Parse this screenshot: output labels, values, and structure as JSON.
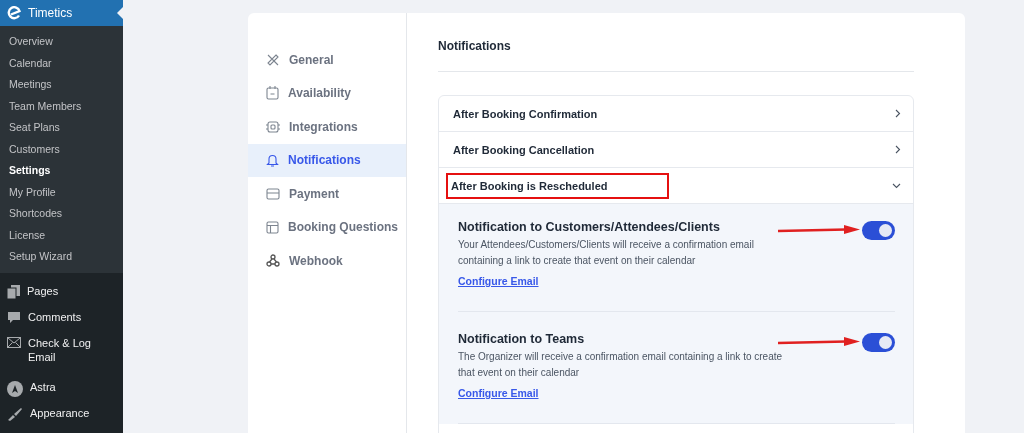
{
  "admin_menu": {
    "app": {
      "label": "Timetics"
    },
    "submenu": [
      {
        "label": "Overview",
        "selected": false
      },
      {
        "label": "Calendar",
        "selected": false
      },
      {
        "label": "Meetings",
        "selected": false
      },
      {
        "label": "Team Members",
        "selected": false
      },
      {
        "label": "Seat Plans",
        "selected": false
      },
      {
        "label": "Customers",
        "selected": false
      },
      {
        "label": "Settings",
        "selected": true
      },
      {
        "label": "My Profile",
        "selected": false
      },
      {
        "label": "Shortcodes",
        "selected": false
      },
      {
        "label": "License",
        "selected": false
      },
      {
        "label": "Setup Wizard",
        "selected": false
      }
    ],
    "items": [
      {
        "label": "Pages"
      },
      {
        "label": "Comments"
      },
      {
        "label": "Check & Log Email"
      },
      {
        "label": "Astra"
      },
      {
        "label": "Appearance"
      }
    ]
  },
  "settings_nav": [
    {
      "label": "General",
      "selected": false
    },
    {
      "label": "Availability",
      "selected": false
    },
    {
      "label": "Integrations",
      "selected": false
    },
    {
      "label": "Notifications",
      "selected": true
    },
    {
      "label": "Payment",
      "selected": false
    },
    {
      "label": "Booking Questions",
      "selected": false
    },
    {
      "label": "Webhook",
      "selected": false
    }
  ],
  "heading": "Notifications",
  "accordion": [
    {
      "title": "After Booking Confirmation",
      "expanded": false,
      "highlighted": false
    },
    {
      "title": "After Booking Cancellation",
      "expanded": false,
      "highlighted": false
    },
    {
      "title": "After Booking is Rescheduled",
      "expanded": true,
      "highlighted": true,
      "settings": [
        {
          "title": "Notification to Customers/Attendees/Clients",
          "description": "Your Attendees/Customers/Clients will receive a confirmation email containing a link to create that event on their calendar",
          "link": "Configure Email",
          "on": true,
          "pointed": true
        },
        {
          "title": "Notification to Teams",
          "description": "The Organizer will receive a confirmation email containing a link to create that event on their calendar",
          "link": "Configure Email",
          "on": true,
          "pointed": true
        }
      ]
    }
  ]
}
